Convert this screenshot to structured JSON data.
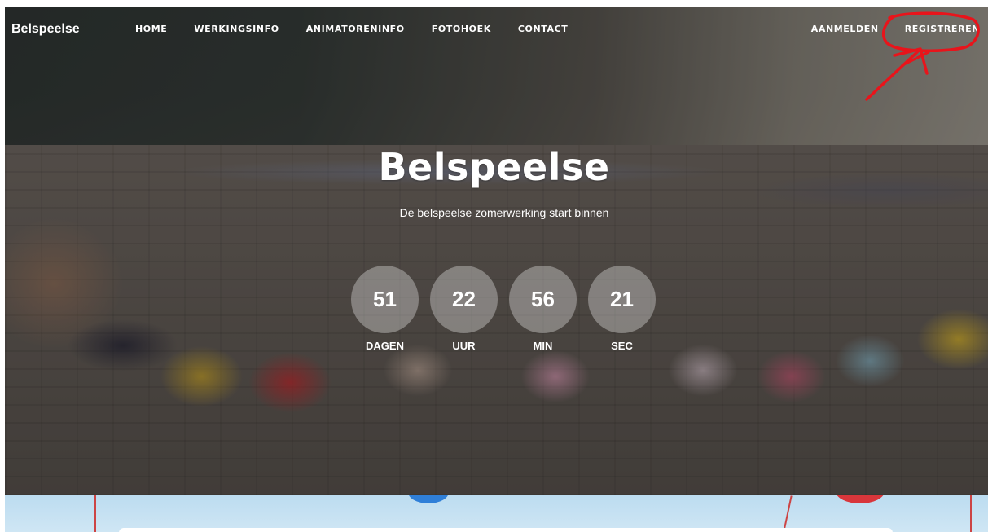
{
  "nav": {
    "brand": "Belspeelse",
    "links": [
      "HOME",
      "WERKINGSINFO",
      "ANIMATORENINFO",
      "FOTOHOEK",
      "CONTACT"
    ],
    "right_links": [
      "AANMELDEN",
      "REGISTREREN"
    ]
  },
  "hero": {
    "title": "Belspeelse",
    "subtitle": "De belspeelse zomerwerking start binnen"
  },
  "countdown": [
    {
      "value": "51",
      "label": "DAGEN"
    },
    {
      "value": "22",
      "label": "UUR"
    },
    {
      "value": "56",
      "label": "MIN"
    },
    {
      "value": "21",
      "label": "SEC"
    }
  ],
  "colors": {
    "text": "#ffffff",
    "annotation": "#e8141b",
    "countdown_circle": "rgba(255,255,255,0.32)"
  },
  "icons": {
    "annotation": "red-circle-arrow-annotation"
  }
}
